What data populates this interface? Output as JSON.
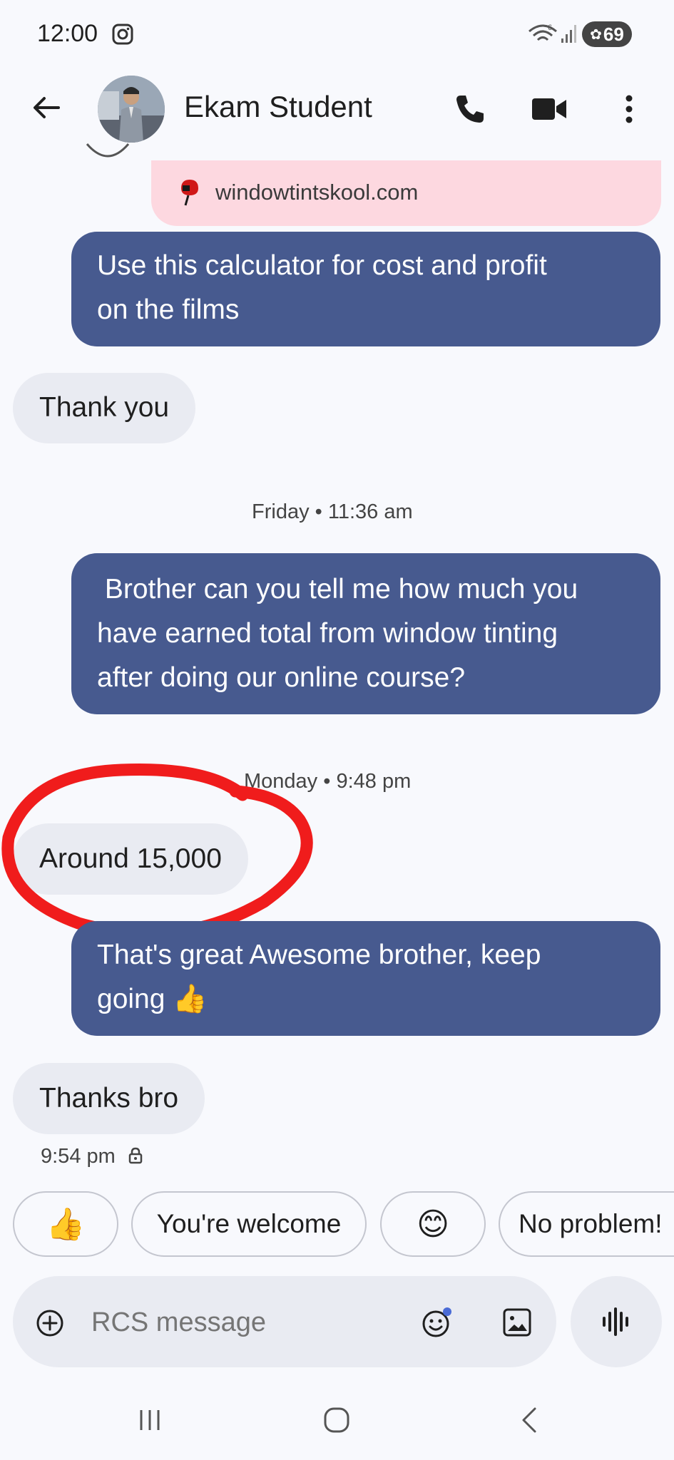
{
  "status_bar": {
    "time": "12:00",
    "battery": "69",
    "icons": [
      "instagram-icon",
      "wifi-icon",
      "signal-icon",
      "battery-icon"
    ]
  },
  "header": {
    "contact_name": "Ekam Student",
    "icons": [
      "back-arrow-icon",
      "avatar",
      "phone-icon",
      "video-call-icon",
      "more-vert-icon"
    ]
  },
  "messages": {
    "link_preview": "windowtintskool.com",
    "m1": [
      "Use this calculator for cost and profit",
      "on the films"
    ],
    "m2": "Thank you",
    "ts1": "Friday • 11:36 am",
    "m3": [
      " Brother can you tell me how much you",
      "have earned total from window tinting",
      "after doing our online course?"
    ],
    "ts2": "Monday • 9:48 pm",
    "m4": "Around 15,000",
    "m5": [
      "That's great Awesome brother, keep",
      "going 👍"
    ],
    "m6": "Thanks bro",
    "last_time": "9:54 pm"
  },
  "suggestions": {
    "s1": "👍",
    "s2": "You're welcome",
    "s3": "😊",
    "s4": "No problem!"
  },
  "composer": {
    "placeholder": "RCS message"
  },
  "colors": {
    "outgoing_bubble": "#475a8f",
    "incoming_bubble": "#e9ebf2",
    "link_preview_bg": "#fdd8e0",
    "annotation": "#f01c1c"
  }
}
